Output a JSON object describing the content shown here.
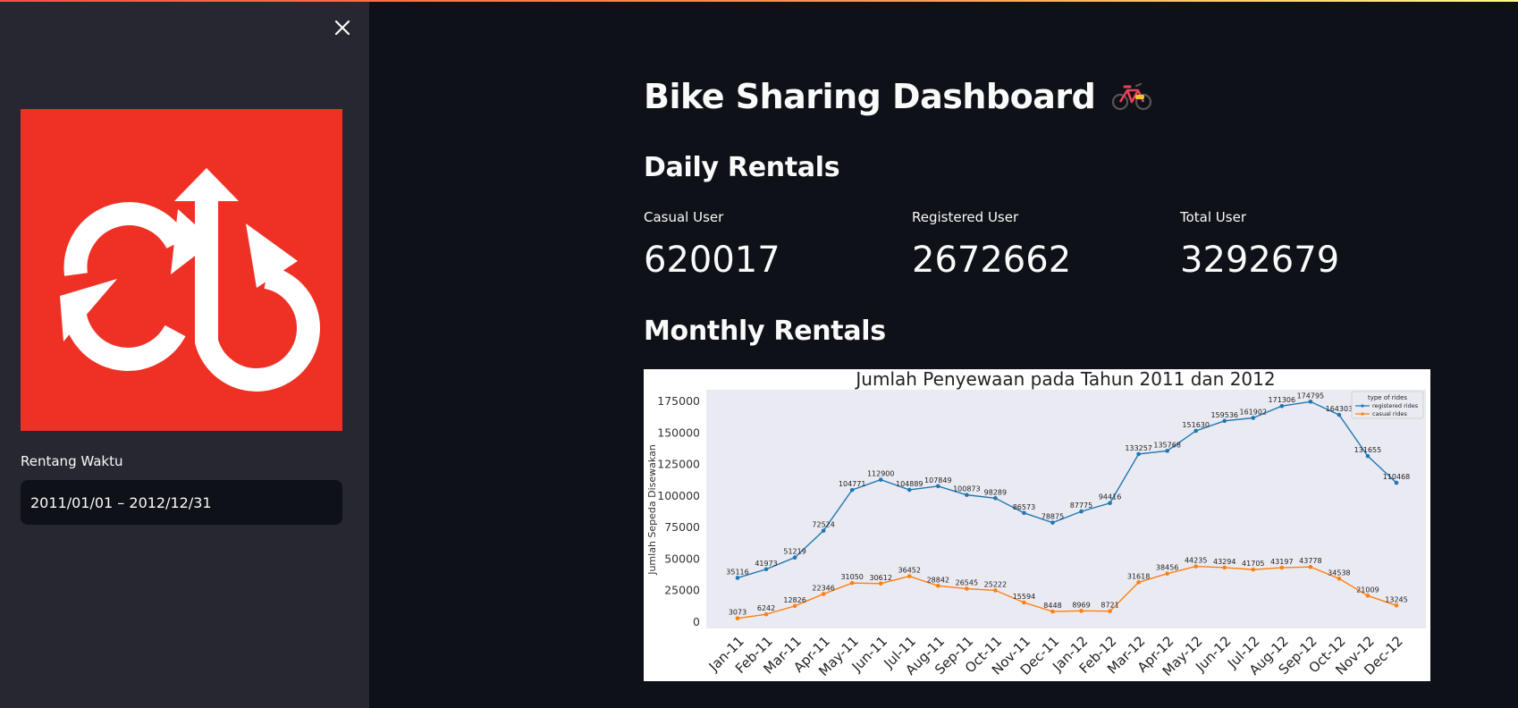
{
  "sidebar": {
    "close_icon": "close-icon",
    "logo_icon": "bike-share-logo",
    "logo_color": "#ef3125",
    "date_label": "Rentang Waktu",
    "date_value": "2011/01/01 – 2012/12/31"
  },
  "header": {
    "title": "Bike Sharing Dashboard",
    "title_icon": "bicycle-icon"
  },
  "daily": {
    "heading": "Daily Rentals",
    "metrics": [
      {
        "label": "Casual User",
        "value": "620017"
      },
      {
        "label": "Registered User",
        "value": "2672662"
      },
      {
        "label": "Total User",
        "value": "3292679"
      }
    ]
  },
  "monthly": {
    "heading": "Monthly Rentals"
  },
  "chart_data": {
    "type": "line",
    "title": "Jumlah Penyewaan pada Tahun 2011 dan 2012",
    "xlabel": "",
    "ylabel": "Jumlah Sepeda Disewakan",
    "ylim": [
      0,
      185000
    ],
    "yticks": [
      0,
      25000,
      50000,
      75000,
      100000,
      125000,
      150000,
      175000
    ],
    "grid": false,
    "legend_title": "type of rides",
    "legend_position": "top-right",
    "categories": [
      "Jan-11",
      "Feb-11",
      "Mar-11",
      "Apr-11",
      "May-11",
      "Jun-11",
      "Jul-11",
      "Aug-11",
      "Sep-11",
      "Oct-11",
      "Nov-11",
      "Dec-11",
      "Jan-12",
      "Feb-12",
      "Mar-12",
      "Apr-12",
      "May-12",
      "Jun-12",
      "Jul-12",
      "Aug-12",
      "Sep-12",
      "Oct-12",
      "Nov-12",
      "Dec-12"
    ],
    "series": [
      {
        "name": "registered rides",
        "color": "#1f77b4",
        "values": [
          35116,
          41973,
          51219,
          72524,
          104771,
          112900,
          104889,
          107849,
          100873,
          98289,
          86573,
          78875,
          87775,
          94416,
          133257,
          135768,
          151630,
          159536,
          161902,
          171306,
          174795,
          164303,
          131655,
          110468
        ]
      },
      {
        "name": "casual rides",
        "color": "#ff7f0e",
        "values": [
          3073,
          6242,
          12826,
          22346,
          31050,
          30612,
          36452,
          28842,
          26545,
          25222,
          15594,
          8448,
          8969,
          8721,
          31618,
          38456,
          44235,
          43294,
          41705,
          43197,
          43778,
          34538,
          21009,
          13245
        ]
      }
    ]
  }
}
